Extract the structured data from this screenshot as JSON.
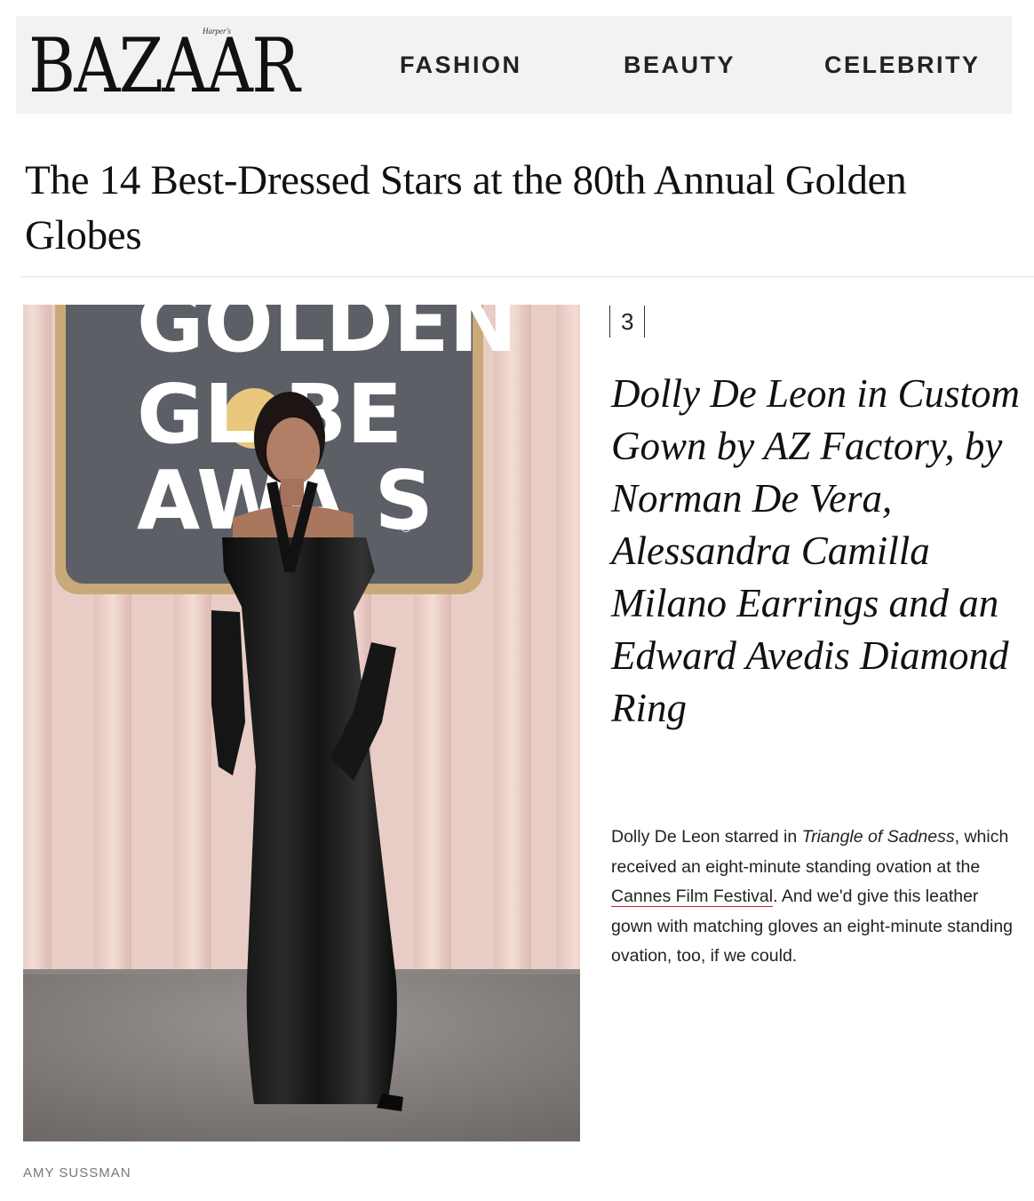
{
  "header": {
    "logo_text": "BAZAAR",
    "logo_tag": "Harper's",
    "nav": [
      "FASHION",
      "BEAUTY",
      "CELEBRITY"
    ]
  },
  "article": {
    "headline": "The 14 Best-Dressed Stars at the 80th Annual Golden Globes"
  },
  "photo": {
    "backdrop_lines": [
      "GOLDEN",
      "GL  BE",
      "AWA  S"
    ],
    "credit": "AMY SUSSMAN"
  },
  "slide": {
    "number": "3",
    "title": "Dolly De Leon in Custom Gown by AZ Factory, by Norman De Vera, Alessandra Camilla Milano Earrings and an Edward Avedis Diamond Ring",
    "body_1": "Dolly De Leon starred in ",
    "body_film": "Triangle of Sadness",
    "body_2": ", which received an eight-minute standing ovation at the ",
    "body_link": "Cannes Film Festival",
    "body_3": ". And we'd give this leather gown with matching gloves an eight-minute standing ovation, too, if we could."
  },
  "colors": {
    "header_bg": "#f2f2f2",
    "link_underline": "#c9202e",
    "wall_pink": "#edd2cb"
  }
}
